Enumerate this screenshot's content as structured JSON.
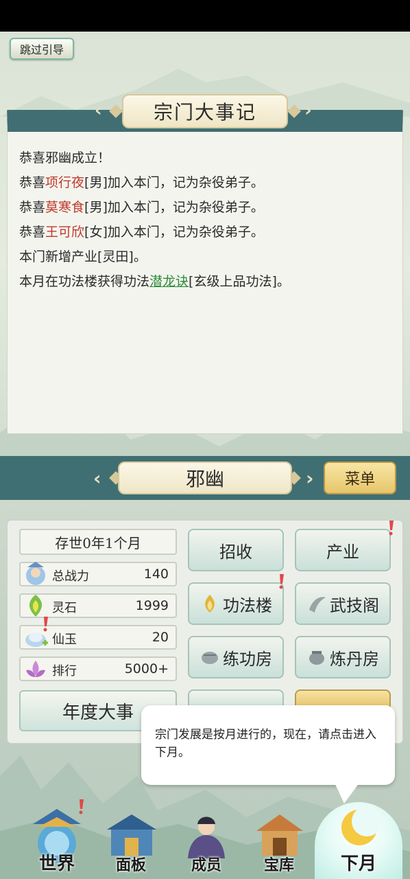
{
  "skip_button": "跳过引导",
  "chronicle": {
    "title": "宗门大事记",
    "lines": [
      {
        "pre": "恭喜邪幽成立！",
        "name": "",
        "post": ""
      },
      {
        "pre": "恭喜",
        "name": "项行夜",
        "post": "[男]加入本门，记为杂役弟子。"
      },
      {
        "pre": "恭喜",
        "name": "莫寒食",
        "post": "[男]加入本门，记为杂役弟子。"
      },
      {
        "pre": "恭喜",
        "name": "王可欣",
        "post": "[女]加入本门，记为杂役弟子。"
      },
      {
        "pre": "本门新增产业[灵田]。",
        "name": "",
        "post": ""
      },
      {
        "pre": "本月在功法楼获得功法",
        "skill": "潜龙诀",
        "post": "[玄级上品功法]。"
      }
    ]
  },
  "sect": {
    "name": "邪幽",
    "menu_label": "菜单"
  },
  "stats": {
    "era": "存世0年1个月",
    "power_label": "总战力",
    "power_value": "140",
    "spirit_stone_label": "灵石",
    "spirit_stone_value": "1999",
    "jade_label": "仙玉",
    "jade_value": "20",
    "rank_label": "排行",
    "rank_value": "5000+",
    "annual_label": "年度大事"
  },
  "buildings": {
    "recruit": "招收",
    "industry": "产业",
    "library": "功法楼",
    "martial": "武技阁",
    "training": "练功房",
    "alchemy": "炼丹房"
  },
  "tooltip": "宗门发展是按月进行的，现在，请点击进入下月。",
  "nav": {
    "world": "世界",
    "panel": "面板",
    "members": "成员",
    "treasury": "宝库",
    "next_month": "下月"
  },
  "colors": {
    "panel_header": "#406e72",
    "member_name": "#c0392b",
    "skill_name": "#2e8b3a",
    "badge": "#e04848"
  }
}
